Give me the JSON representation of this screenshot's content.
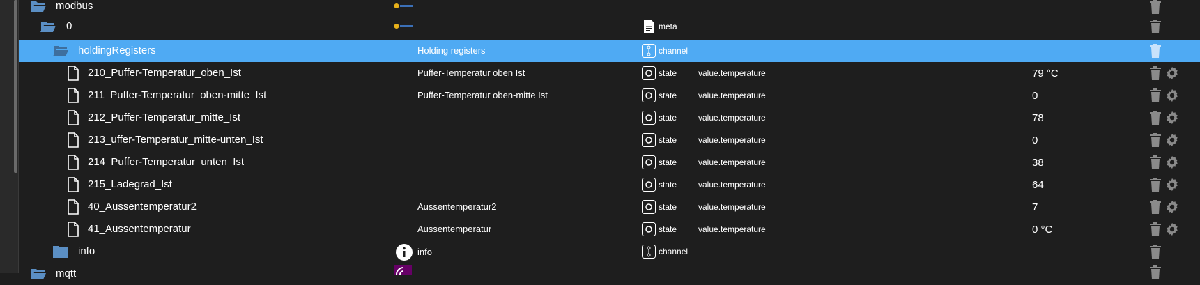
{
  "colors": {
    "background": "#1e1e1e",
    "selected_row": "#4faaf3",
    "folder_icon": "#5b8fc4",
    "text": "#ffffff",
    "icon_gray": "#8a8a8a"
  },
  "rows": [
    {
      "name": "modbus",
      "desc": "",
      "type": "",
      "role": "",
      "value": "",
      "icon": "folder-open-icon"
    },
    {
      "name": "0",
      "desc": "",
      "type": "meta",
      "role": "",
      "value": "",
      "icon": "folder-open-icon"
    },
    {
      "name": "holdingRegisters",
      "desc": "Holding registers",
      "type": "channel",
      "role": "",
      "value": "",
      "icon": "folder-open-icon"
    },
    {
      "name": "210_Puffer-Temperatur_oben_Ist",
      "desc": "Puffer-Temperatur oben Ist",
      "type": "state",
      "role": "value.temperature",
      "value": "79 °C",
      "icon": "file-icon"
    },
    {
      "name": "211_Puffer-Temperatur_oben-mitte_Ist",
      "desc": "Puffer-Temperatur oben-mitte Ist",
      "type": "state",
      "role": "value.temperature",
      "value": "0",
      "icon": "file-icon"
    },
    {
      "name": "212_Puffer-Temperatur_mitte_Ist",
      "desc": "",
      "type": "state",
      "role": "value.temperature",
      "value": "78",
      "icon": "file-icon"
    },
    {
      "name": "213_uffer-Temperatur_mitte-unten_Ist",
      "desc": "",
      "type": "state",
      "role": "value.temperature",
      "value": "0",
      "icon": "file-icon"
    },
    {
      "name": "214_Puffer-Temperatur_unten_Ist",
      "desc": "",
      "type": "state",
      "role": "value.temperature",
      "value": "38",
      "icon": "file-icon"
    },
    {
      "name": "215_Ladegrad_Ist",
      "desc": "",
      "type": "state",
      "role": "value.temperature",
      "value": "64",
      "icon": "file-icon"
    },
    {
      "name": "40_Aussentemperatur2",
      "desc": "Aussentemperatur2",
      "type": "state",
      "role": "value.temperature",
      "value": "7",
      "icon": "file-icon"
    },
    {
      "name": "41_Aussentemperatur",
      "desc": "Aussentemperatur",
      "type": "state",
      "role": "value.temperature",
      "value": "0 °C",
      "icon": "file-icon"
    },
    {
      "name": "info",
      "desc": "info",
      "type": "channel",
      "role": "",
      "value": "",
      "icon": "folder-icon"
    },
    {
      "name": "mqtt",
      "desc": "",
      "type": "",
      "role": "",
      "value": "",
      "icon": "folder-open-icon"
    }
  ]
}
